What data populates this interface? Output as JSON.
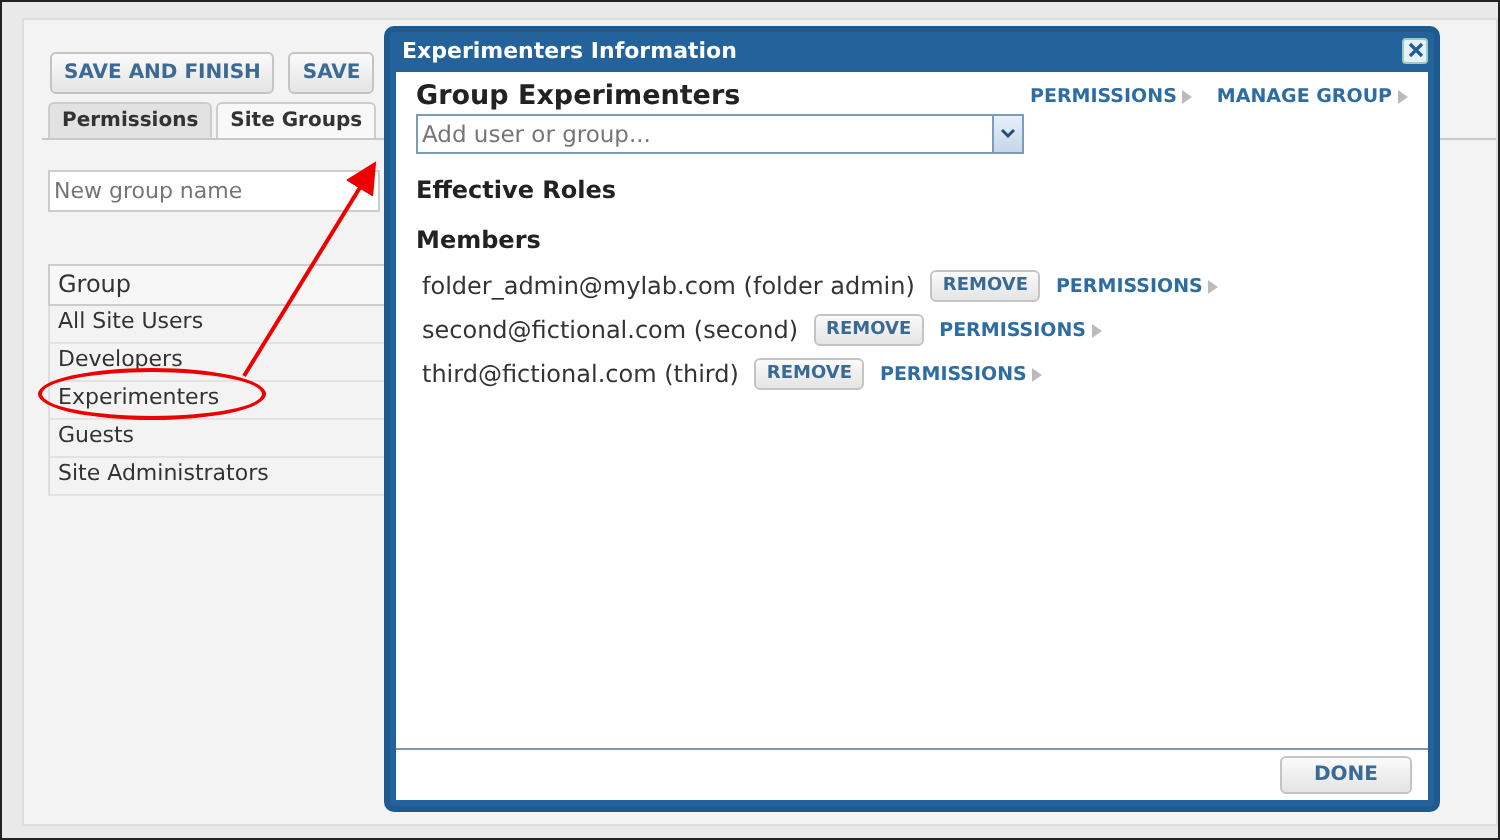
{
  "toolbar": {
    "buttons": [
      "SAVE AND FINISH",
      "SAVE"
    ]
  },
  "tabs": [
    {
      "label": "Permissions",
      "selected": false
    },
    {
      "label": "Site Groups",
      "selected": true
    }
  ],
  "new_group": {
    "placeholder": "New group name"
  },
  "groups": {
    "header": "Group",
    "rows": [
      {
        "label": "All Site Users",
        "highlighted": false
      },
      {
        "label": "Developers",
        "highlighted": false
      },
      {
        "label": "Experimenters",
        "highlighted": true
      },
      {
        "label": "Guests",
        "highlighted": false
      },
      {
        "label": "Site Administrators",
        "highlighted": false
      }
    ]
  },
  "dialog": {
    "title": "Experimenters Information",
    "heading": "Group Experimenters",
    "links": [
      "PERMISSIONS",
      "MANAGE GROUP"
    ],
    "add_field": {
      "placeholder": "Add user or group..."
    },
    "sections": [
      "Effective Roles",
      "Members"
    ],
    "members": [
      {
        "name": "folder_admin@mylab.com (folder admin)",
        "button": "REMOVE",
        "link": "PERMISSIONS"
      },
      {
        "name": "second@fictional.com (second)",
        "button": "REMOVE",
        "link": "PERMISSIONS"
      },
      {
        "name": "third@fictional.com (third)",
        "button": "REMOVE",
        "link": "PERMISSIONS"
      }
    ],
    "footer_button": "DONE"
  }
}
